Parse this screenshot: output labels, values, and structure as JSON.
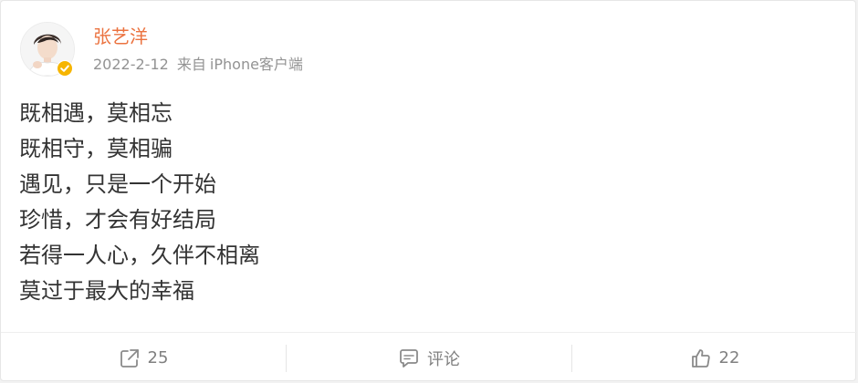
{
  "post": {
    "username": "张艺洋",
    "date": "2022-2-12",
    "source_prefix": "来自",
    "source": "iPhone客户端",
    "lines": [
      "既相遇，莫相忘",
      "既相守，莫相骗",
      "遇见，只是一个开始",
      "珍惜，才会有好结局",
      "若得一人心，久伴不相离",
      "莫过于最大的幸福"
    ]
  },
  "footer": {
    "repost_count": "25",
    "comment_label": "评论",
    "like_count": "22"
  },
  "colors": {
    "username": "#eb7340",
    "meta": "#939393",
    "body_text": "#333333",
    "action_text": "#808080",
    "verified_badge": "#f6b500"
  },
  "icons": {
    "repost": "share-icon",
    "comment": "comment-icon",
    "like": "thumbs-up-icon",
    "verified": "verified-badge-icon"
  }
}
